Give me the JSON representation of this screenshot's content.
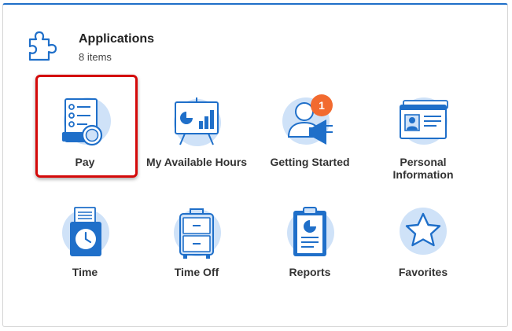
{
  "header": {
    "title": "Applications",
    "count": "8 items"
  },
  "apps": [
    {
      "label": "Pay"
    },
    {
      "label": "My Available Hours"
    },
    {
      "label": "Getting Started",
      "badge": "1"
    },
    {
      "label": "Personal Information"
    },
    {
      "label": "Time"
    },
    {
      "label": "Time Off"
    },
    {
      "label": "Reports"
    },
    {
      "label": "Favorites"
    }
  ],
  "colors": {
    "accent": "#1f6fc9",
    "highlight": "#d40a0a",
    "badge": "#f26a2f",
    "icon_bg": "#cfe2f8"
  },
  "icons": [
    "puzzle-icon",
    "pay-icon",
    "presentation-chart-icon",
    "megaphone-person-icon",
    "id-card-icon",
    "time-clock-icon",
    "luggage-icon",
    "report-clipboard-icon",
    "star-icon"
  ]
}
